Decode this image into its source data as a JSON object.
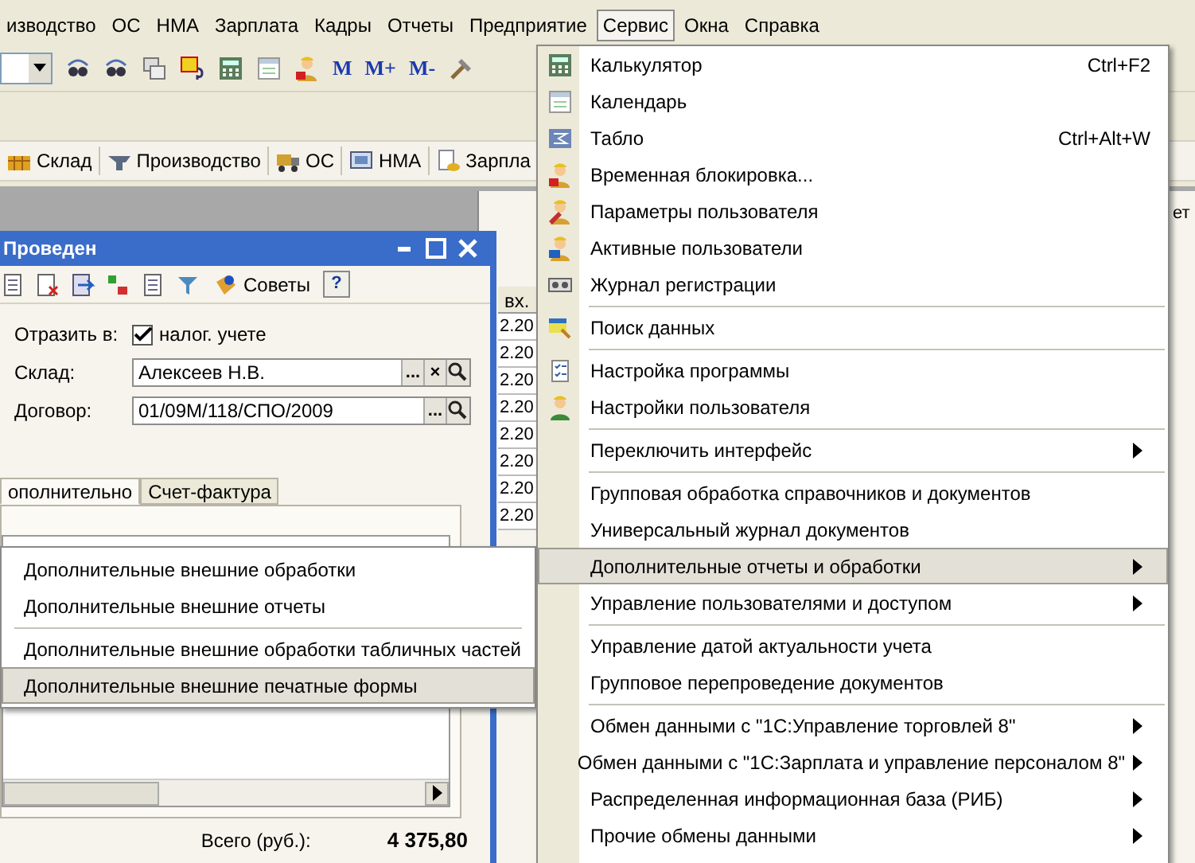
{
  "menubar": [
    {
      "label": "изводство",
      "selected": false
    },
    {
      "label": "ОС",
      "selected": false
    },
    {
      "label": "НМА",
      "selected": false
    },
    {
      "label": "Зарплата",
      "selected": false
    },
    {
      "label": "Кадры",
      "selected": false
    },
    {
      "label": "Отчеты",
      "selected": false
    },
    {
      "label": "Предприятие",
      "selected": false
    },
    {
      "label": "Сервис",
      "selected": true
    },
    {
      "label": "Окна",
      "selected": false
    },
    {
      "label": "Справка",
      "selected": false
    }
  ],
  "toolbar": {
    "memory_buttons": [
      "M",
      "M+",
      "M-"
    ]
  },
  "panel": [
    "Склад",
    "Производство",
    "ОС",
    "НМА",
    "Зарпла"
  ],
  "background_list": {
    "header": "вх.",
    "rows": [
      "2.20",
      "2.20",
      "2.20",
      "2.20",
      "2.20",
      "2.20",
      "2.20",
      "2.20"
    ],
    "side_text": "ет"
  },
  "document_window": {
    "title": "Проведен",
    "tips_button": "Советы",
    "help_button": "?",
    "fields": [
      {
        "kind": "checkbox",
        "label": "Отразить в:",
        "value": "налог. учете",
        "checked": true
      },
      {
        "kind": "reference",
        "label": "Склад:",
        "value": "Алексеев Н.В.",
        "actions": [
          "...",
          "×"
        ]
      },
      {
        "kind": "reference",
        "label": "Договор:",
        "value": "01/09М/118/СПО/2009",
        "actions": [
          "..."
        ]
      }
    ],
    "tabs": [
      {
        "label": "ополнительно",
        "selected": true
      },
      {
        "label": "Счет-фактура",
        "selected": false
      }
    ],
    "total": {
      "label": "Всего (руб.):",
      "value": "4 375,80"
    }
  },
  "submenu": {
    "items": [
      {
        "kind": "item",
        "label": "Дополнительные внешние обработки",
        "selected": false
      },
      {
        "kind": "item",
        "label": "Дополнительные внешние отчеты",
        "selected": false
      },
      {
        "kind": "separator"
      },
      {
        "kind": "item",
        "label": "Дополнительные внешние обработки табличных частей",
        "selected": false
      },
      {
        "kind": "item",
        "label": "Дополнительные внешние печатные формы",
        "selected": true
      }
    ]
  },
  "service_menu": {
    "items": [
      {
        "kind": "item",
        "label": "Калькулятор",
        "shortcut": "Ctrl+F2",
        "has_submenu": false,
        "selected": false
      },
      {
        "kind": "item",
        "label": "Календарь",
        "has_submenu": false,
        "selected": false
      },
      {
        "kind": "item",
        "label": "Табло",
        "shortcut": "Ctrl+Alt+W",
        "has_submenu": false,
        "selected": false
      },
      {
        "kind": "item",
        "label": "Временная блокировка...",
        "has_submenu": false,
        "selected": false
      },
      {
        "kind": "item",
        "label": "Параметры пользователя",
        "has_submenu": false,
        "selected": false
      },
      {
        "kind": "item",
        "label": "Активные пользователи",
        "has_submenu": false,
        "selected": false
      },
      {
        "kind": "item",
        "label": "Журнал регистрации",
        "has_submenu": false,
        "selected": false
      },
      {
        "kind": "separator"
      },
      {
        "kind": "item",
        "label": "Поиск данных",
        "has_submenu": false,
        "selected": false
      },
      {
        "kind": "separator"
      },
      {
        "kind": "item",
        "label": "Настройка программы",
        "has_submenu": false,
        "selected": false
      },
      {
        "kind": "item",
        "label": "Настройки пользователя",
        "has_submenu": false,
        "selected": false
      },
      {
        "kind": "separator"
      },
      {
        "kind": "item",
        "label": "Переключить интерфейс",
        "has_submenu": true,
        "selected": false
      },
      {
        "kind": "separator"
      },
      {
        "kind": "item",
        "label": "Групповая обработка справочников и документов",
        "has_submenu": false,
        "selected": false
      },
      {
        "kind": "item",
        "label": "Универсальный журнал документов",
        "has_submenu": false,
        "selected": false
      },
      {
        "kind": "item",
        "label": "Дополнительные отчеты и обработки",
        "has_submenu": true,
        "selected": true
      },
      {
        "kind": "item",
        "label": "Управление пользователями и доступом",
        "has_submenu": true,
        "selected": false
      },
      {
        "kind": "separator"
      },
      {
        "kind": "item",
        "label": "Управление датой актуальности учета",
        "has_submenu": false,
        "selected": false
      },
      {
        "kind": "item",
        "label": "Групповое перепроведение документов",
        "has_submenu": false,
        "selected": false
      },
      {
        "kind": "separator"
      },
      {
        "kind": "item",
        "label": "Обмен данными с \"1С:Управление торговлей 8\"",
        "has_submenu": true,
        "selected": false
      },
      {
        "kind": "item",
        "label": "Обмен данными с \"1С:Зарплата и управление персоналом 8\"",
        "has_submenu": true,
        "selected": false
      },
      {
        "kind": "item",
        "label": "Распределенная информационная база (РИБ)",
        "has_submenu": true,
        "selected": false
      },
      {
        "kind": "item",
        "label": "Прочие обмены данными",
        "has_submenu": true,
        "selected": false
      }
    ]
  }
}
